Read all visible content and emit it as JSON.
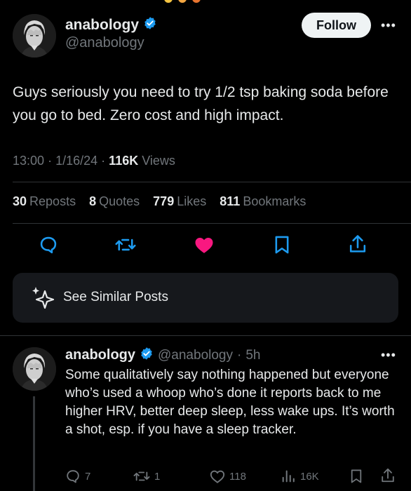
{
  "tweet": {
    "display_name": "anabology",
    "handle": "@anabology",
    "follow_label": "Follow",
    "more_label": "•••",
    "text": "Guys seriously you need to try 1/2 tsp baking soda before you go to bed. Zero cost and high impact.",
    "time": "13:00",
    "date": "1/16/24",
    "separator": "·",
    "views_count": "116K",
    "views_label": "Views",
    "reposts_count": "30",
    "reposts_label": "Reposts",
    "quotes_count": "8",
    "quotes_label": "Quotes",
    "likes_count": "779",
    "likes_label": "Likes",
    "bookmarks_count": "811",
    "bookmarks_label": "Bookmarks",
    "similar_label": "See Similar Posts",
    "like_color": "#f91880"
  },
  "reply": {
    "display_name": "anabology",
    "handle": "@anabology",
    "age": "5h",
    "separator": "·",
    "more_label": "•••",
    "text": "Some qualitatively say nothing happened but everyone who’s used a whoop who’s done it reports back to me higher HRV, better deep sleep, less wake ups. It’s worth a shot, esp. if you have a sleep tracker.",
    "replies": "7",
    "reposts": "1",
    "likes": "118",
    "views": "16K"
  },
  "colors": {
    "verified": "#1d9bf0",
    "muted": "#71767b",
    "background": "#000000"
  }
}
